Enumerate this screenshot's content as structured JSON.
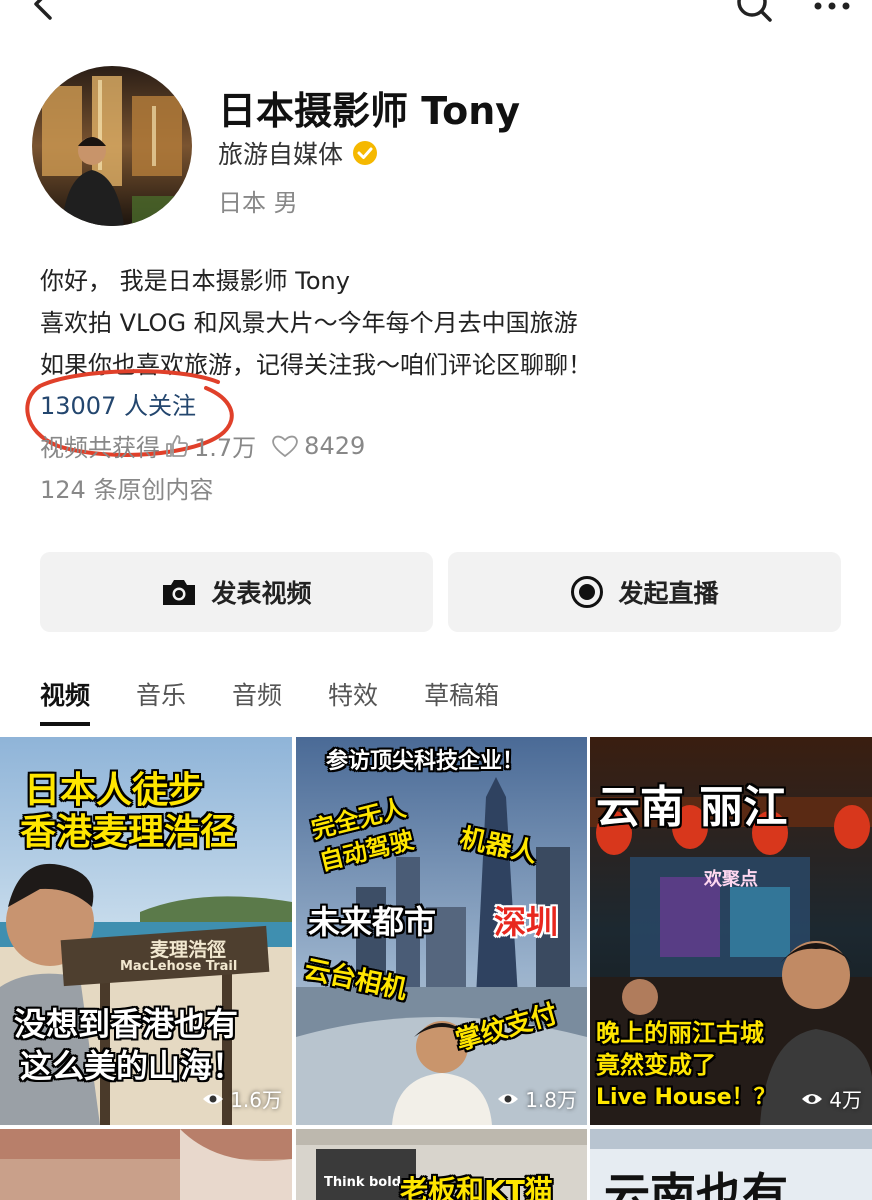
{
  "profile": {
    "name": "日本摄影师 Tony",
    "role": "旅游自媒体",
    "meta": "日本 男",
    "bio": [
      "你好， 我是日本摄影师 Tony",
      "喜欢拍 VLOG 和风景大片～今年每个月去中国旅游",
      "如果你也喜欢旅游，记得关注我～咱们评论区聊聊！"
    ],
    "followers": "13007 人关注",
    "stats": {
      "label": "视频共获得",
      "likes": "1.7万",
      "favorites": "8429"
    },
    "original_count": "124 条原创内容"
  },
  "actions": {
    "post_video": "发表视频",
    "start_live": "发起直播"
  },
  "tabs": [
    "视频",
    "音乐",
    "音频",
    "特效",
    "草稿箱"
  ],
  "videos": [
    {
      "caption_top": [
        "日本人徒步",
        "香港麦理浩径"
      ],
      "sign": "麦理浩徑",
      "sign_en": "MacLehose Trail",
      "caption_bottom": [
        "没想到香港也有",
        "这么美的山海！"
      ],
      "views": "1.6万"
    },
    {
      "caption_top": "参访顶尖科技企业！",
      "tags": [
        "完全无人",
        "自动驾驶",
        "机器人",
        "未来都市",
        "深圳",
        "云台相机",
        "掌纹支付"
      ],
      "views": "1.8万"
    },
    {
      "caption_top": "云南  丽江",
      "sign": "欢聚点",
      "caption_bottom": [
        "晚上的丽江古城",
        "竟然变成了",
        "Live House！？"
      ],
      "views": "4万"
    },
    {
      "caption": ""
    },
    {
      "caption": "老板和KT猫",
      "small": "Think bold"
    },
    {
      "caption": "云南也有"
    }
  ],
  "colors": {
    "accent_link": "#23466e",
    "verify": "#f5b800",
    "annotation": "#e0402a"
  }
}
